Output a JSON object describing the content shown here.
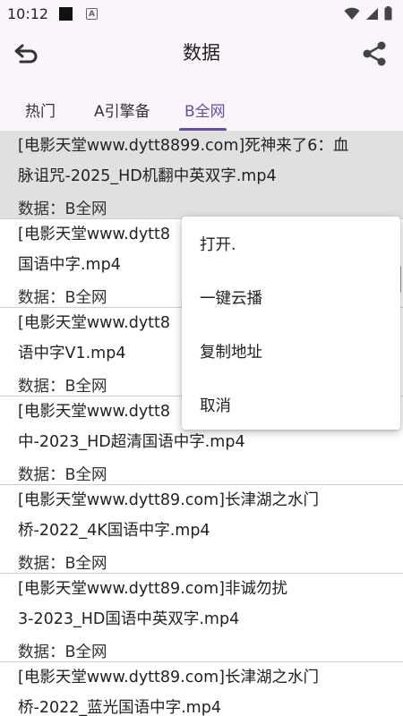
{
  "status_bar": {
    "time": "10:12",
    "notif_icon_letter": "A"
  },
  "app_bar": {
    "title": "数据"
  },
  "tabs": [
    {
      "label": "热门"
    },
    {
      "label": "A引擎备"
    },
    {
      "label": "B全网"
    }
  ],
  "list": [
    {
      "line1": "[电影天堂www.dytt8899.com]死神来了6：血",
      "line2": "脉诅咒-2025_HD机翻中英双字.mp4",
      "meta": "数据：B全网"
    },
    {
      "line1": "[电影天堂www.dytt8",
      "line2": "国语中字.mp4",
      "meta": "数据：B全网"
    },
    {
      "line1": "[电影天堂www.dytt8",
      "line2": "语中字V1.mp4",
      "meta": "数据：B全网"
    },
    {
      "line1": "[电影天堂www.dytt8",
      "line2": "中-2023_HD超清国语中字.mp4",
      "meta": "数据：B全网"
    },
    {
      "line1": "[电影天堂www.dytt89.com]长津湖之水门",
      "line2": "桥-2022_4K国语中字.mp4",
      "meta": "数据：B全网"
    },
    {
      "line1": "[电影天堂www.dytt89.com]非诚勿扰",
      "line2": "3-2023_HD国语中英双字.mp4",
      "meta": "数据：B全网"
    },
    {
      "line1": "[电影天堂www.dytt89.com]长津湖之水门",
      "line2": "桥-2022_蓝光国语中字.mp4",
      "meta": ""
    }
  ],
  "context_menu": [
    {
      "label": "打开."
    },
    {
      "label": "一键云播"
    },
    {
      "label": "复制地址"
    },
    {
      "label": "取消"
    }
  ],
  "colors": {
    "accent": "#6750a4",
    "bar_bg": "#faf5fb",
    "selected_row": "#e0e0e0"
  }
}
